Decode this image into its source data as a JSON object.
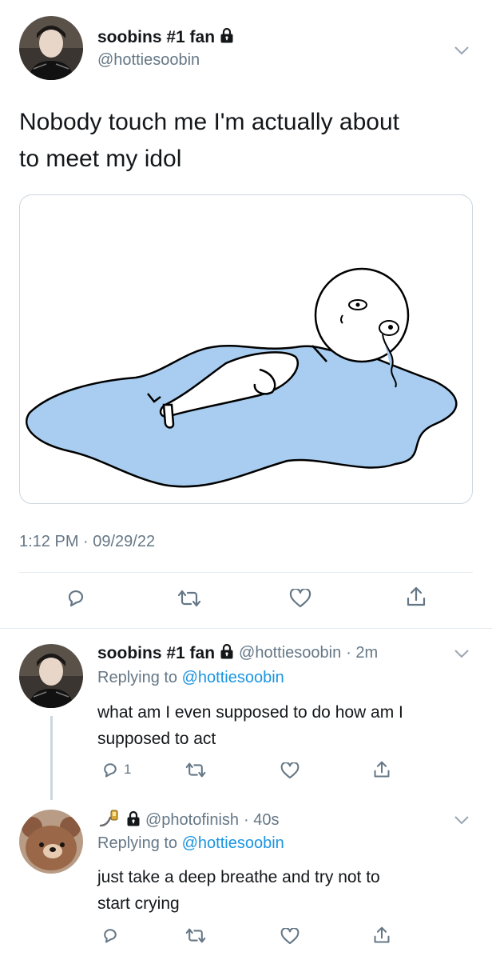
{
  "main_tweet": {
    "display_name": "soobins #1 fan",
    "handle": "@hottiesoobin",
    "text_line1": "Nobody touch me I'm actually about",
    "text_line2": "to meet my idol",
    "timestamp": "1:12 PM · 09/29/22"
  },
  "reply1": {
    "display_name": "soobins #1 fan",
    "handle": "@hottiesoobin",
    "age": "· 2m",
    "replying_prefix": "Replying to ",
    "replying_to": "@hottiesoobin",
    "text_line1": "what am I even supposed to do how am I",
    "text_line2": "supposed to act",
    "reply_count": "1"
  },
  "reply2": {
    "handle": "@photofinish",
    "age": "· 40s",
    "replying_prefix": "Replying to ",
    "replying_to": "@hottiesoobin",
    "text_line1": "just take a deep breathe and try not to",
    "text_line2": "start crying"
  },
  "icons": [
    "lock-icon",
    "chevron-down-icon",
    "reply-icon",
    "retweet-icon",
    "like-icon",
    "share-icon"
  ],
  "colors": {
    "link": "#1b95e0",
    "secondary": "#657786",
    "divider": "#e6ecf0",
    "puddle": "#a8cdf0"
  }
}
